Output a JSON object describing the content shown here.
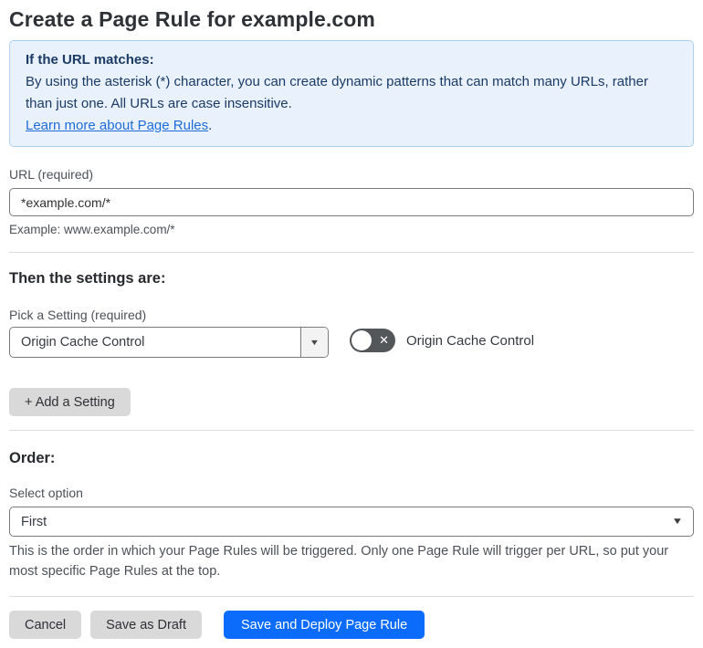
{
  "page": {
    "title": "Create a Page Rule for example.com"
  },
  "info_box": {
    "heading": "If the URL matches:",
    "body": "By using the asterisk (*) character, you can create dynamic patterns that can match many URLs, rather than just one. All URLs are case insensitive.",
    "link_label": "Learn more about Page Rules",
    "link_suffix": "."
  },
  "url_field": {
    "label": "URL (required)",
    "value": "*example.com/*",
    "helper": "Example: www.example.com/*"
  },
  "settings_section": {
    "heading": "Then the settings are:",
    "picker_label": "Pick a Setting (required)",
    "picker_value": "Origin Cache Control",
    "toggle_label": "Origin Cache Control",
    "toggle_state": "off",
    "add_setting_label": "+ Add a Setting"
  },
  "order_section": {
    "heading": "Order:",
    "select_label": "Select option",
    "select_value": "First",
    "helper": "This is the order in which your Page Rules will be triggered. Only one Page Rule will trigger per URL, so put your most specific Page Rules at the top."
  },
  "footer": {
    "cancel_label": "Cancel",
    "save_draft_label": "Save as Draft",
    "save_deploy_label": "Save and Deploy Page Rule"
  },
  "icons": {
    "caret_down": "▼",
    "toggle_off_x": "✕"
  },
  "colors": {
    "info_box_bg": "#e9f2fc",
    "info_box_border": "#b0cfee",
    "info_box_text": "#1b3a66",
    "link_blue": "#1f6bd8",
    "primary_button_blue": "#0b6cfb",
    "secondary_button_gray": "#d9d9d9",
    "toggle_off_gray": "#54575a",
    "input_border": "#7b7b7b",
    "divider": "#dcdcdc"
  }
}
